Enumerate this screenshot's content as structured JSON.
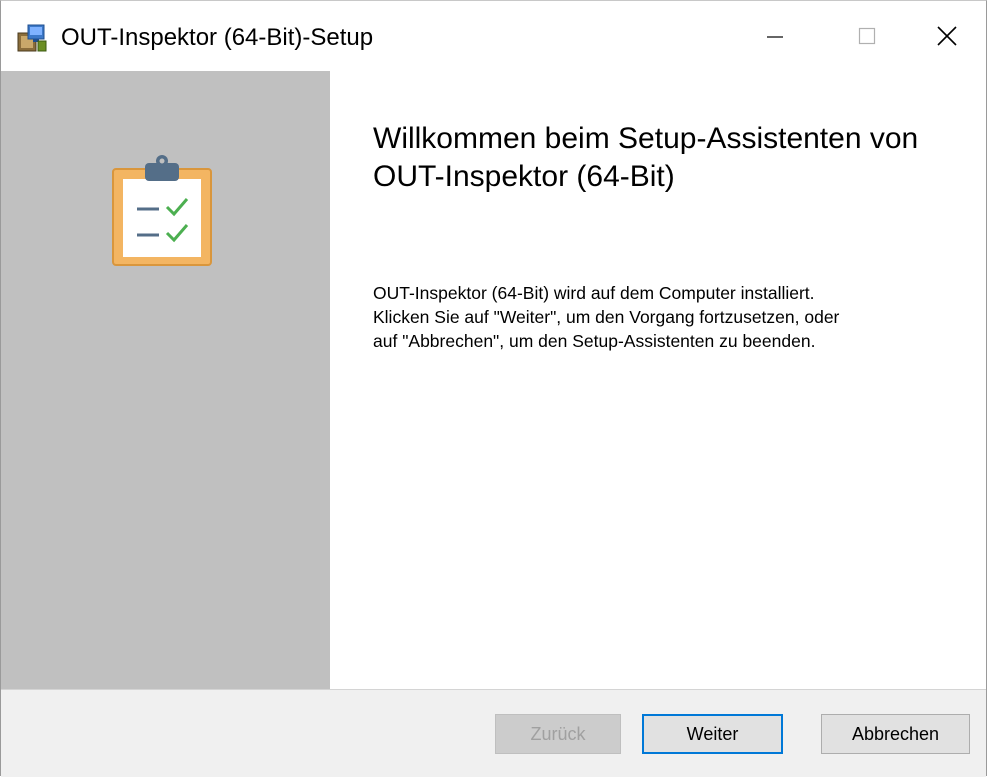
{
  "window": {
    "title": "OUT-Inspektor (64-Bit)-Setup"
  },
  "titlebar": {
    "icons": [
      "installer-icon",
      "minimize-icon",
      "maximize-icon",
      "close-icon"
    ]
  },
  "sidebar": {
    "background": "#c0c0c0",
    "icon": "clipboard-checklist-icon"
  },
  "main": {
    "heading": "Willkommen beim Setup-Assistenten von OUT-Inspektor (64-Bit)",
    "description_lines": [
      "OUT-Inspektor (64-Bit) wird auf dem Computer installiert.",
      "Klicken Sie auf \"Weiter\", um den Vorgang fortzusetzen, oder",
      "auf \"Abbrechen\", um den Setup-Assistenten zu beenden."
    ]
  },
  "footer": {
    "back_label": "Zurück",
    "next_label": "Weiter",
    "cancel_label": "Abbrechen"
  },
  "colors": {
    "accent": "#0078d7",
    "clipboard_frame": "#f3b562",
    "clipboard_border": "#d9963c",
    "clip_top": "#546e88",
    "check": "#4caf50",
    "dash": "#546e88"
  }
}
